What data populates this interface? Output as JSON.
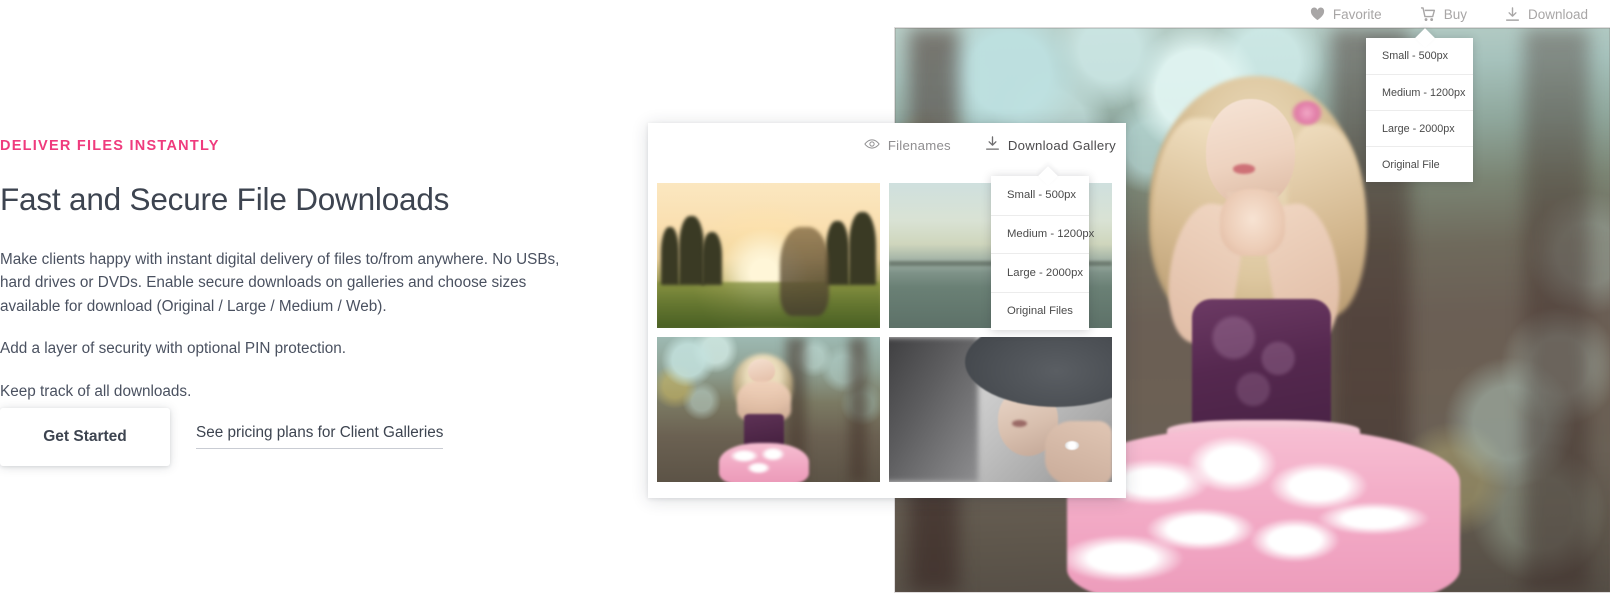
{
  "hero": {
    "eyebrow": "DELIVER FILES INSTANTLY",
    "headline": "Fast and Secure File Downloads",
    "paragraphs": [
      "Make clients happy with instant digital delivery of files to/from anywhere. No USBs, hard drives or DVDs. Enable secure downloads on galleries and choose sizes available for download (Original / Large / Medium / Web).",
      "Add a layer of security with optional PIN protection.",
      "Keep track of all downloads."
    ],
    "primary_button": "Get Started",
    "secondary_link": "See pricing plans for Client Galleries",
    "accent_color": "#ef3b7d",
    "heading_color": "#3d4450"
  },
  "hero_toolbar": {
    "items": [
      {
        "label": "Favorite",
        "icon": "heart-icon"
      },
      {
        "label": "Buy",
        "icon": "cart-icon"
      },
      {
        "label": "Download",
        "icon": "download-icon"
      }
    ]
  },
  "hero_dropdown": {
    "items": [
      "Small - 500px",
      "Medium - 1200px",
      "Large - 2000px",
      "Original File"
    ]
  },
  "gallery_card": {
    "toolbar": [
      {
        "label": "Filenames",
        "icon": "eye-icon"
      },
      {
        "label": "Download Gallery",
        "icon": "download-icon"
      }
    ],
    "dropdown": {
      "items": [
        "Small - 500px",
        "Medium - 1200px",
        "Large - 2000px",
        "Original Files"
      ]
    },
    "thumbnails": [
      {
        "name": "sunset-field-photo"
      },
      {
        "name": "seaside-dusk-photo"
      },
      {
        "name": "blonde-forest-photo"
      },
      {
        "name": "woman-with-hat-photo"
      }
    ]
  }
}
